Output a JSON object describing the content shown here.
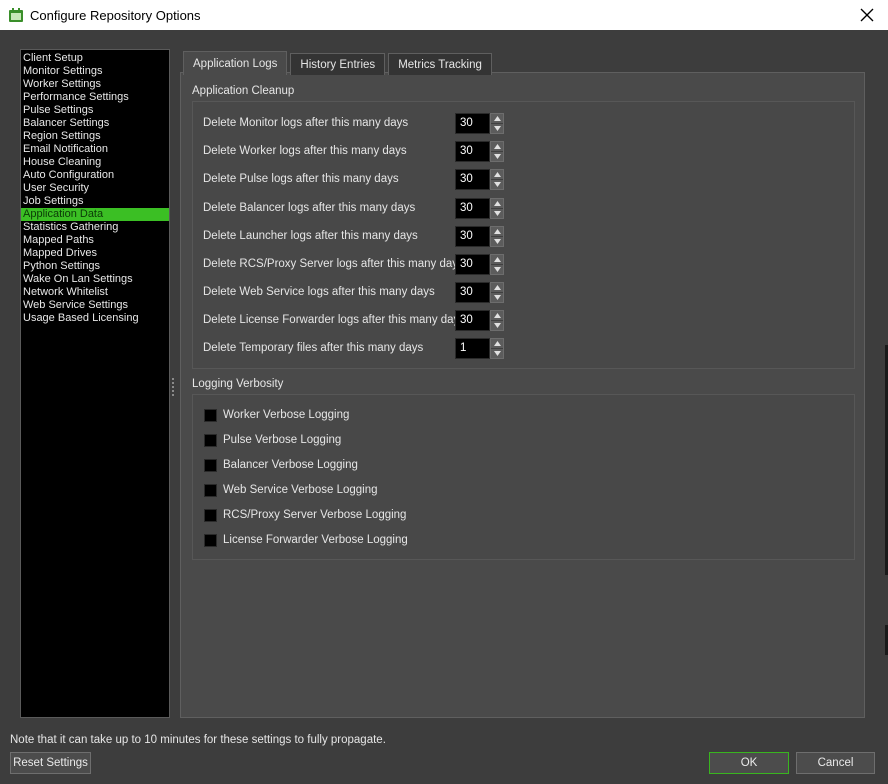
{
  "window": {
    "title": "Configure Repository Options",
    "icon": "app-window-icon",
    "close_icon": "close-icon"
  },
  "sidebar": {
    "selected_color": "#3bbf24",
    "items": [
      {
        "label": "Client Setup"
      },
      {
        "label": "Monitor Settings"
      },
      {
        "label": "Worker Settings"
      },
      {
        "label": "Performance Settings"
      },
      {
        "label": "Pulse Settings"
      },
      {
        "label": "Balancer Settings"
      },
      {
        "label": "Region Settings"
      },
      {
        "label": "Email Notification"
      },
      {
        "label": "House Cleaning"
      },
      {
        "label": "Auto Configuration"
      },
      {
        "label": "User Security"
      },
      {
        "label": "Job Settings"
      },
      {
        "label": "Application Data",
        "selected": true
      },
      {
        "label": "Statistics Gathering"
      },
      {
        "label": "Mapped Paths"
      },
      {
        "label": "Mapped Drives"
      },
      {
        "label": "Python Settings"
      },
      {
        "label": "Wake On Lan Settings"
      },
      {
        "label": "Network Whitelist"
      },
      {
        "label": "Web Service Settings"
      },
      {
        "label": "Usage Based Licensing"
      }
    ]
  },
  "tabs": [
    {
      "label": "Application Logs",
      "active": true
    },
    {
      "label": "History Entries",
      "active": false
    },
    {
      "label": "Metrics Tracking",
      "active": false
    }
  ],
  "cleanup": {
    "title": "Application Cleanup",
    "rows": [
      {
        "label": "Delete Monitor logs after this many days",
        "value": "30"
      },
      {
        "label": "Delete Worker logs after this many days",
        "value": "30"
      },
      {
        "label": "Delete Pulse logs after this many days",
        "value": "30"
      },
      {
        "label": "Delete Balancer logs after this many days",
        "value": "30"
      },
      {
        "label": "Delete Launcher logs after this many days",
        "value": "30"
      },
      {
        "label": "Delete RCS/Proxy Server logs after this many days",
        "value": "30"
      },
      {
        "label": "Delete Web Service logs after this many days",
        "value": "30"
      },
      {
        "label": "Delete License Forwarder logs after this many days",
        "value": "30"
      },
      {
        "label": "Delete Temporary files after this many days",
        "value": "1"
      }
    ]
  },
  "verbosity": {
    "title": "Logging Verbosity",
    "items": [
      {
        "label": "Worker Verbose Logging",
        "checked": false
      },
      {
        "label": "Pulse Verbose Logging",
        "checked": false
      },
      {
        "label": "Balancer Verbose Logging",
        "checked": false
      },
      {
        "label": "Web Service Verbose Logging",
        "checked": false
      },
      {
        "label": "RCS/Proxy Server Verbose Logging",
        "checked": false
      },
      {
        "label": "License Forwarder Verbose Logging",
        "checked": false
      }
    ]
  },
  "footer": {
    "note": "Note that it can take up to 10 minutes for these settings to fully propagate.",
    "reset_label": "Reset Settings",
    "ok_label": "OK",
    "cancel_label": "Cancel"
  }
}
